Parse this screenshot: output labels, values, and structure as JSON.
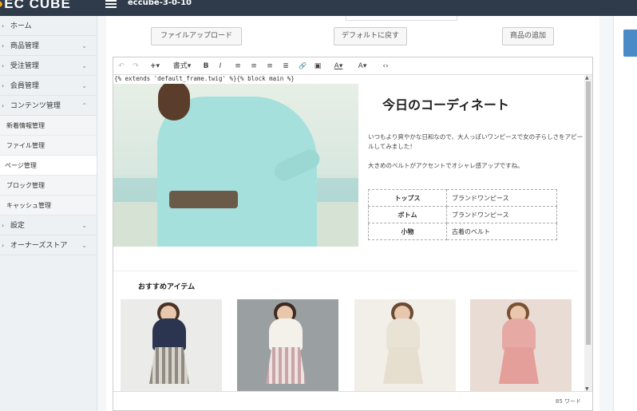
{
  "header": {
    "logo": "EC CUBE",
    "site_name": "eccube-3-0-10"
  },
  "sidebar": {
    "items": [
      {
        "label": "ホーム",
        "chevron": ""
      },
      {
        "label": "商品管理",
        "chevron": "⌄"
      },
      {
        "label": "受注管理",
        "chevron": "⌄"
      },
      {
        "label": "会員管理",
        "chevron": "⌄"
      },
      {
        "label": "コンテンツ管理",
        "chevron": "⌃"
      }
    ],
    "sub_items": [
      {
        "label": "新着情報管理"
      },
      {
        "label": "ファイル管理"
      },
      {
        "label": "ページ管理"
      },
      {
        "label": "ブロック管理"
      },
      {
        "label": "キャッシュ管理"
      }
    ],
    "bottom_items": [
      {
        "label": "設定",
        "chevron": "⌄"
      },
      {
        "label": "オーナーズストア",
        "chevron": "⌄"
      }
    ]
  },
  "toolbar_buttons": {
    "upload": "ファイルアップロード",
    "default": "デフォルトに戻す",
    "add_product": "商品の追加"
  },
  "editor_toolbar": {
    "undo": "↶",
    "redo": "↷",
    "insert": "+▾",
    "format": "書式▾",
    "bold": "B",
    "italic": "I",
    "align_left": "≡",
    "align_center": "≡",
    "align_right": "≡",
    "justify": "≣",
    "link": "🔗",
    "image": "▣",
    "font_color": "A▾",
    "bg_color": "A▾",
    "source": "‹›"
  },
  "editor": {
    "code_line": "{% extends 'default_frame.twig' %}{% block main %}",
    "title": "今日のコーディネート",
    "paragraph1": "いつもより爽やかな日和なので、大人っぽいワンピースで女の子らしさをアピールしてみました！",
    "paragraph2": "大きめのベルトがアクセントでオシャレ感アップですね。",
    "table": [
      {
        "label": "トップス",
        "value": "ブランドワンピース"
      },
      {
        "label": "ボトム",
        "value": "ブランドワンピース"
      },
      {
        "label": "小物",
        "value": "古着のベルト"
      }
    ],
    "section_title": "おすすめアイテム",
    "word_count": "85 ワード"
  },
  "colors": {
    "header_bg": "#2f3b4a",
    "accent": "#4a8ac6"
  }
}
